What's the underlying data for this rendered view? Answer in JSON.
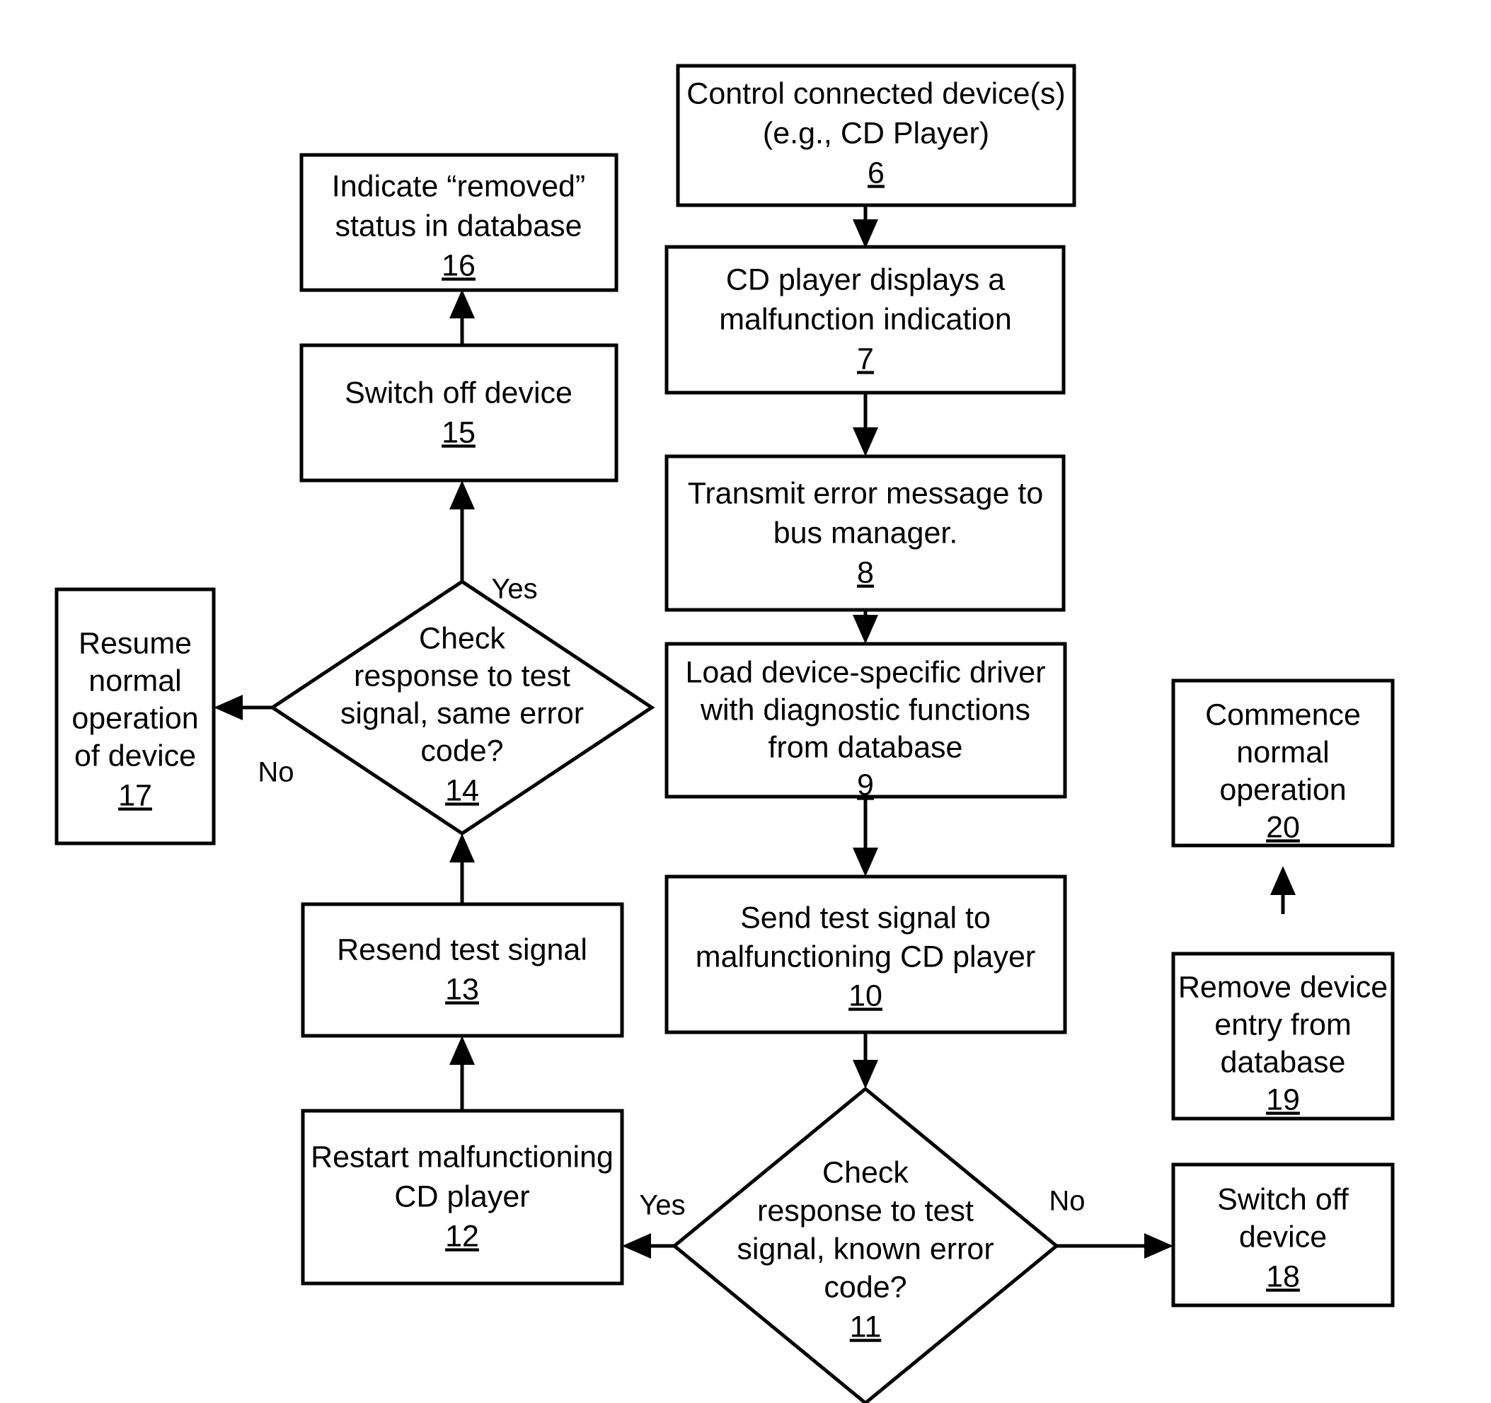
{
  "diagram": {
    "type": "flowchart",
    "title": "",
    "nodes": [
      {
        "id": "n6",
        "shape": "rect",
        "ref": "6",
        "lines": [
          "Control connected device(s)",
          "(e.g., CD Player)"
        ]
      },
      {
        "id": "n7",
        "shape": "rect",
        "ref": "7",
        "lines": [
          "CD player displays a",
          "malfunction indication"
        ]
      },
      {
        "id": "n8",
        "shape": "rect",
        "ref": "8",
        "lines": [
          "Transmit error message to",
          "bus manager."
        ]
      },
      {
        "id": "n9",
        "shape": "rect",
        "ref": "9",
        "lines": [
          "Load device-specific driver",
          "with diagnostic functions",
          "from database"
        ]
      },
      {
        "id": "n10",
        "shape": "rect",
        "ref": "10",
        "lines": [
          "Send test signal to",
          "malfunctioning CD player"
        ]
      },
      {
        "id": "n11",
        "shape": "diamond",
        "ref": "11",
        "lines": [
          "Check",
          "response to test",
          "signal, known error",
          "code?"
        ]
      },
      {
        "id": "n12",
        "shape": "rect",
        "ref": "12",
        "lines": [
          "Restart malfunctioning",
          "CD player"
        ]
      },
      {
        "id": "n13",
        "shape": "rect",
        "ref": "13",
        "lines": [
          "Resend test signal"
        ]
      },
      {
        "id": "n14",
        "shape": "diamond",
        "ref": "14",
        "lines": [
          "Check",
          "response to test",
          "signal, same error",
          "code?"
        ]
      },
      {
        "id": "n15",
        "shape": "rect",
        "ref": "15",
        "lines": [
          "Switch off device"
        ]
      },
      {
        "id": "n16",
        "shape": "rect",
        "ref": "16",
        "lines": [
          "Indicate “removed”",
          "status in database"
        ]
      },
      {
        "id": "n17",
        "shape": "rect",
        "ref": "17",
        "lines": [
          "Resume",
          "normal",
          "operation",
          "of device"
        ]
      },
      {
        "id": "n18",
        "shape": "rect",
        "ref": "18",
        "lines": [
          "Switch off",
          "device"
        ]
      },
      {
        "id": "n19",
        "shape": "rect",
        "ref": "19",
        "lines": [
          "Remove device",
          "entry from",
          "database"
        ]
      },
      {
        "id": "n20",
        "shape": "rect",
        "ref": "20",
        "lines": [
          "Commence",
          "normal",
          "operation"
        ]
      }
    ],
    "edge_labels": {
      "d11_yes": "Yes",
      "d11_no": "No",
      "d14_yes": "Yes",
      "d14_no": "No"
    },
    "colors": {
      "stroke": "#000000",
      "fill": "#ffffff",
      "text": "#000000"
    }
  }
}
